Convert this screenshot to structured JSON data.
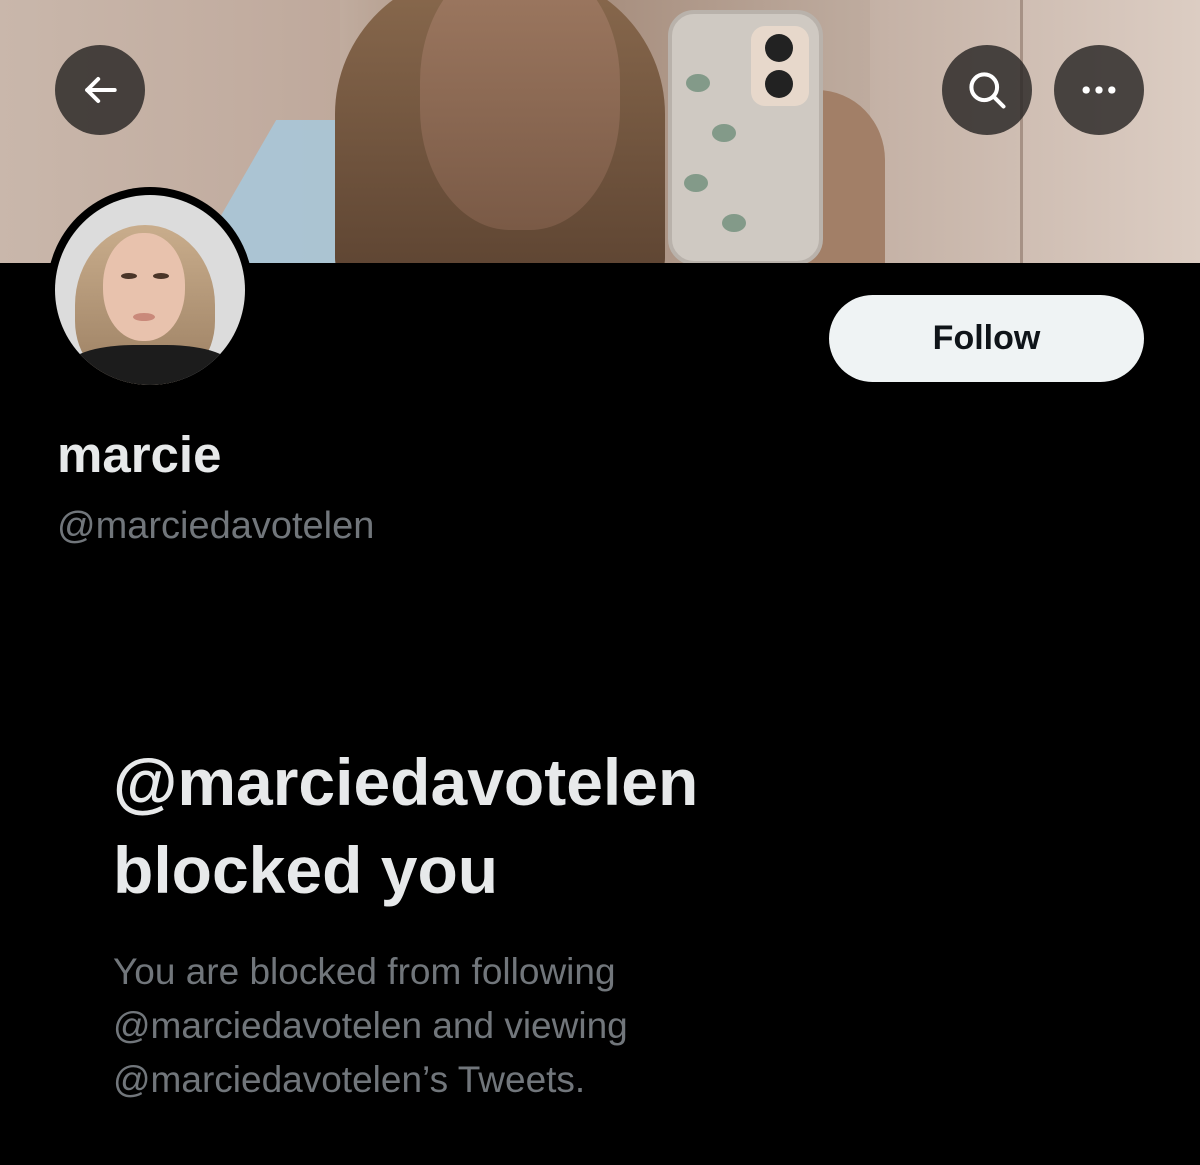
{
  "header": {
    "back_icon": "arrow-left-icon",
    "search_icon": "search-icon",
    "more_icon": "more-horizontal-icon"
  },
  "profile": {
    "display_name": "marcie",
    "handle": "@marciedavotelen",
    "follow_label": "Follow"
  },
  "blocked_notice": {
    "title_line1": "@marciedavotelen",
    "title_line2": "blocked you",
    "desc_line1": "You are blocked from following",
    "desc_line2": "@marciedavotelen and viewing",
    "desc_line3": "@marciedavotelen’s Tweets."
  },
  "colors": {
    "background": "#000000",
    "primary_text": "#e7e9ea",
    "secondary_text": "#71767b",
    "follow_button_bg": "#eff3f4"
  }
}
